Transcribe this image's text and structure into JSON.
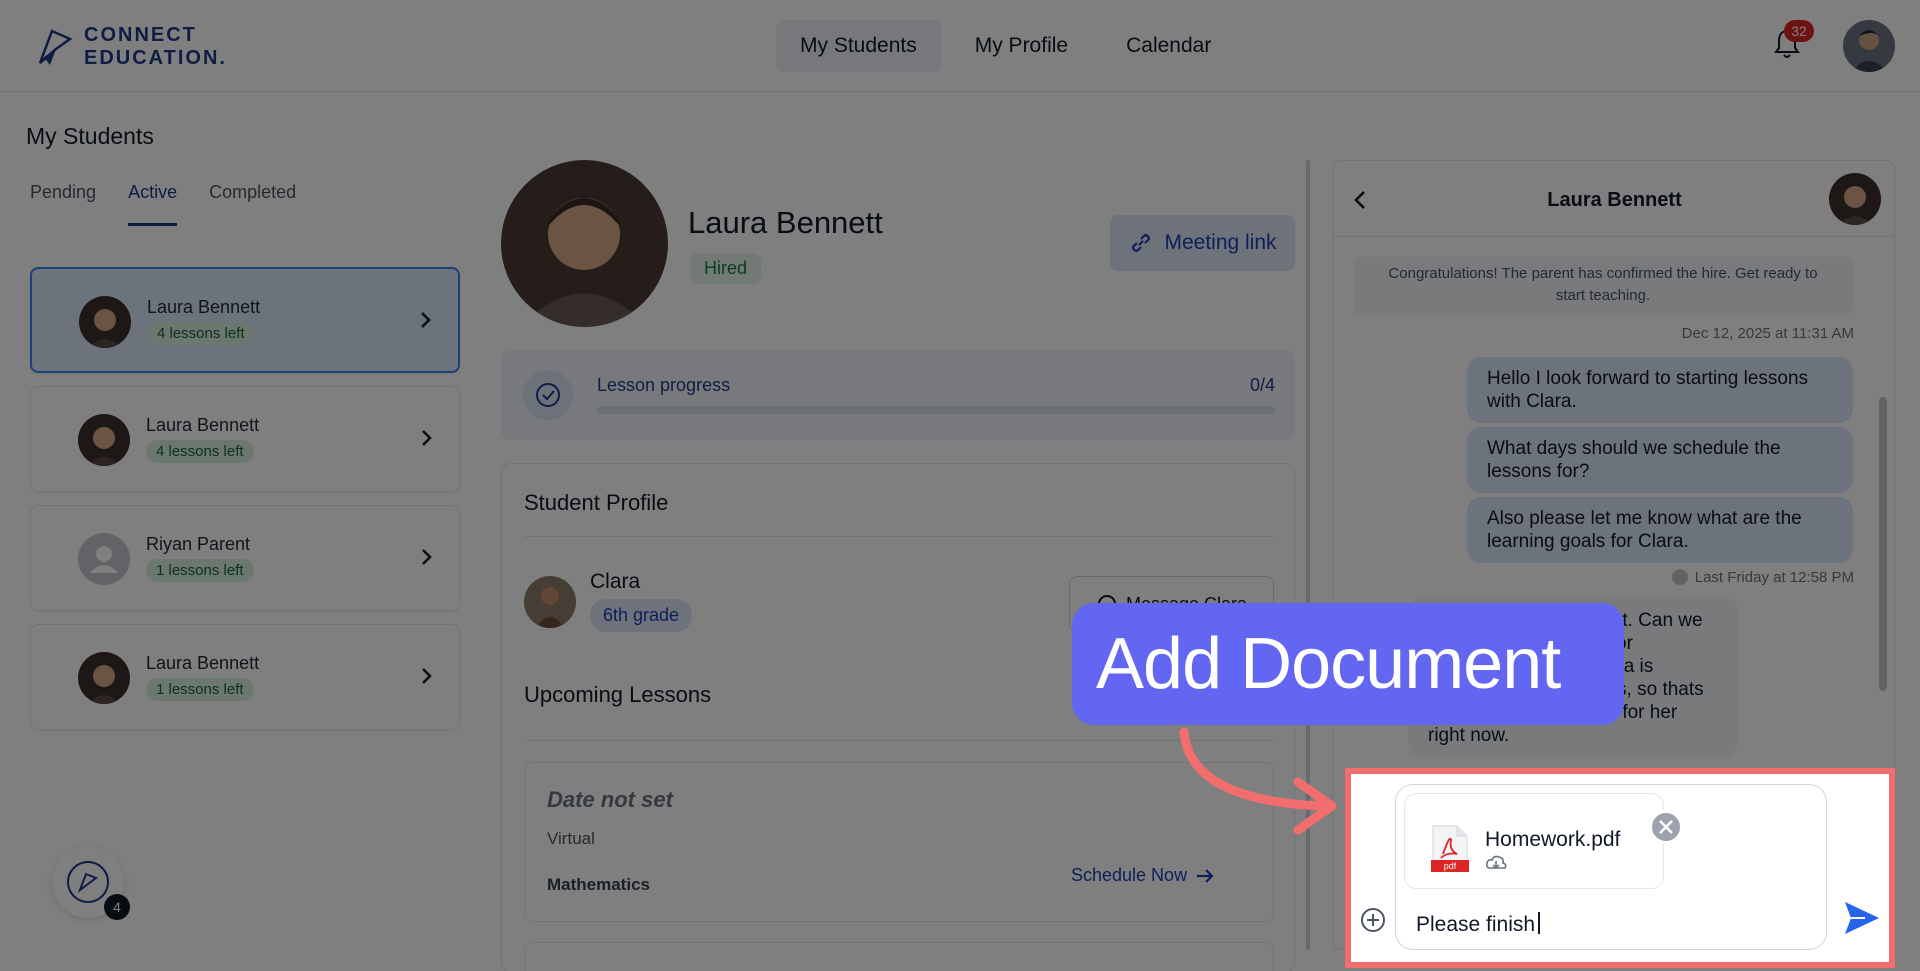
{
  "brand": {
    "line1": "CONNECT",
    "line2": "EDUCATION."
  },
  "nav": {
    "items": [
      "My Students",
      "My Profile",
      "Calendar"
    ]
  },
  "notifications": {
    "count": "32"
  },
  "page": {
    "title": "My Students"
  },
  "tabs": [
    "Pending",
    "Active",
    "Completed"
  ],
  "students": [
    {
      "name": "Laura Bennett",
      "lessons": "4 lessons left"
    },
    {
      "name": "Laura Bennett",
      "lessons": "4 lessons left"
    },
    {
      "name": "Riyan Parent",
      "lessons": "1 lessons left"
    },
    {
      "name": "Laura Bennett",
      "lessons": "1 lessons left"
    }
  ],
  "fab": {
    "badge": "4"
  },
  "profile": {
    "name": "Laura Bennett",
    "status": "Hired",
    "meeting_label": "Meeting link"
  },
  "progress": {
    "label": "Lesson progress",
    "count": "0/4",
    "fraction": 0
  },
  "student_profile": {
    "title": "Student Profile",
    "child_name": "Clara",
    "grade": "6th grade",
    "message_label": "Message Clara"
  },
  "upcoming": {
    "title": "Upcoming Lessons",
    "date": "Date not set",
    "mode": "Virtual",
    "subject": "Mathematics",
    "schedule_label": "Schedule Now"
  },
  "chat": {
    "title": "Laura Bennett",
    "system_message": "Congratulations! The parent has confirmed the hire. Get ready to start teaching.",
    "system_time": "Dec 12, 2025 at 11:31 AM",
    "outgoing": [
      "Hello I look forward to starting lessons with Clara.",
      "What days should we schedule the lessons for?",
      "Also please let me know what are the learning goals for Clara."
    ],
    "outgoing_time": "Last Friday at 12:58 PM",
    "incoming_partial": "Thanks for reaching out. Can we schedule the lessons for Tuesdays at 5 pm. Clara is struggling with fractions, so thats our main area of focus for her right now.",
    "attachment_name": "Homework.pdf",
    "pdf_label": "pdf",
    "draft": "Please finish"
  },
  "callout": {
    "text": "Add Document"
  },
  "colors": {
    "accent": "#1e40af",
    "callout": "#6366f1",
    "highlight": "#f26d6d",
    "send": "#2563eb"
  }
}
